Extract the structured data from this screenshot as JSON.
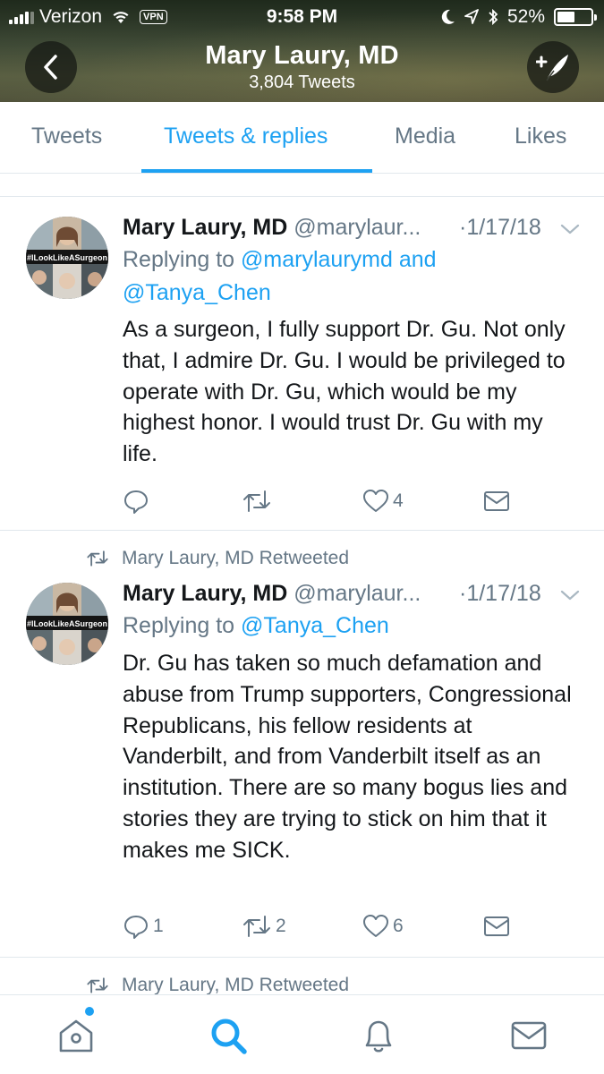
{
  "status_bar": {
    "carrier": "Verizon",
    "vpn": "VPN",
    "time": "9:58 PM",
    "battery": "52%",
    "battery_level": 0.52
  },
  "header": {
    "title": "Mary Laury, MD",
    "subtitle": "3,804 Tweets"
  },
  "tabs": [
    "Tweets",
    "Tweets & replies",
    "Media",
    "Likes"
  ],
  "active_tab": "Tweets & replies",
  "tweets": [
    {
      "avatar_text": "#ILookLikeASurgeon",
      "name": "Mary Laury, MD",
      "handle": "@marylaur...",
      "date": "·1/17/18",
      "replying_prefix": "Replying to ",
      "replying_link1": "@marylaurymd",
      "replying_and": " and",
      "replying_link2": "@Tanya_Chen",
      "text": "As a surgeon, I fully support Dr. Gu. Not only that, I admire Dr. Gu. I would be privileged to operate with Dr. Gu, which would be my highest honor. I would trust Dr. Gu with my life.",
      "likes": "4"
    },
    {
      "retweeted_by": "Mary Laury, MD Retweeted",
      "avatar_text": "#ILookLikeASurgeon",
      "name": "Mary Laury, MD",
      "handle": "@marylaur...",
      "date": "·1/17/18",
      "replying_prefix": "Replying to ",
      "replying_link1": "@Tanya_Chen",
      "text": "Dr. Gu has taken so much defamation and abuse from Trump supporters, Congressional Republicans, his fellow residents at Vanderbilt, and from Vanderbilt itself as an institution. There are so many bogus lies and stories they are trying to stick on him that it makes me SICK.",
      "replies": "1",
      "retweets": "2",
      "likes": "6"
    },
    {
      "retweeted_by": "Mary Laury, MD Retweeted"
    }
  ],
  "icons": {
    "back": "chevron-left-icon",
    "compose": "compose-tweet-icon",
    "reply": "reply-icon",
    "retweet": "retweet-icon",
    "like": "heart-icon",
    "dm": "envelope-icon",
    "home": "home-icon",
    "search": "search-icon",
    "notifications": "bell-icon",
    "messages": "envelope-icon"
  },
  "colors": {
    "accent": "#1da1f2",
    "secondary_text": "#657786",
    "primary_text": "#14171a",
    "divider": "#e1e8ed"
  }
}
